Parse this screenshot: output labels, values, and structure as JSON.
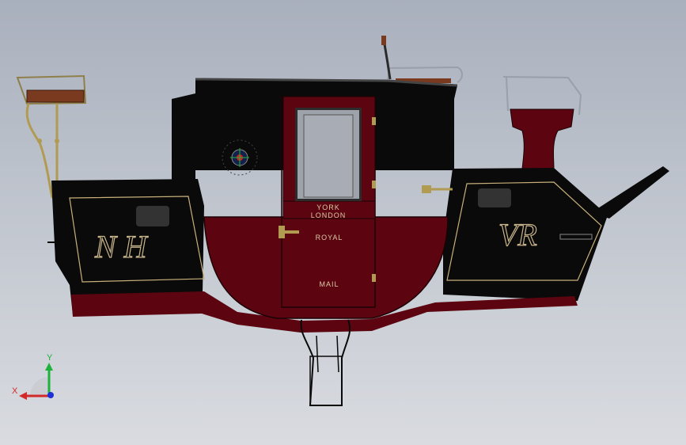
{
  "coach": {
    "destination_line1": "YORK",
    "destination_line2": "LONDON",
    "panel_word_top": "ROYAL",
    "panel_word_bottom": "MAIL",
    "monogram_left": "N H",
    "monogram_right": "VR"
  },
  "triad": {
    "x_label": "X",
    "y_label": "Y",
    "x_color": "#d22a2a",
    "y_color": "#1fb13a",
    "z_color": "#1d2fd6"
  },
  "colors": {
    "body_black": "#0a0a0a",
    "body_maroon": "#5c0510",
    "trim_gold": "#c8b07a"
  }
}
